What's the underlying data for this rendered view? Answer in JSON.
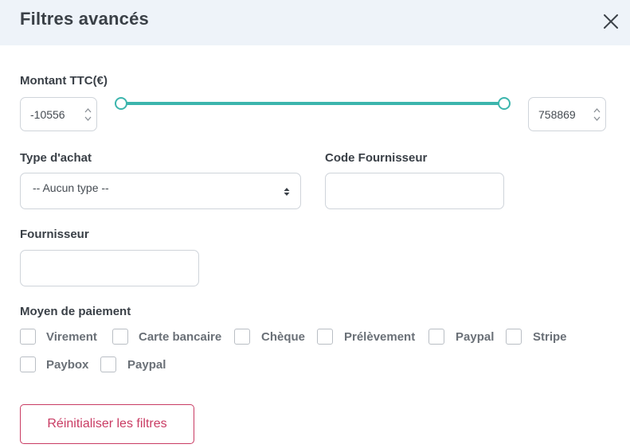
{
  "header": {
    "title": "Filtres avancés"
  },
  "amount": {
    "label": "Montant TTC(€)",
    "min_value": "-10556",
    "max_value": "758869"
  },
  "purchase_type": {
    "label": "Type d'achat",
    "selected": "-- Aucun type --"
  },
  "supplier_code": {
    "label": "Code Fournisseur",
    "value": ""
  },
  "supplier": {
    "label": "Fournisseur",
    "value": ""
  },
  "payment": {
    "label": "Moyen de paiement",
    "options": [
      "Virement",
      "Carte bancaire",
      "Chèque",
      "Prélèvement",
      "Paypal",
      "Stripe",
      "Paybox",
      "Paypal"
    ]
  },
  "actions": {
    "reset_label": "Réinitialiser les filtres"
  },
  "colors": {
    "accent": "#3cb5ad",
    "danger": "#c93b63",
    "header_bg": "#eef3f9"
  },
  "icons": {
    "close": "close-icon",
    "spinner": "spinner-arrows-icon",
    "select": "select-arrows-icon"
  }
}
